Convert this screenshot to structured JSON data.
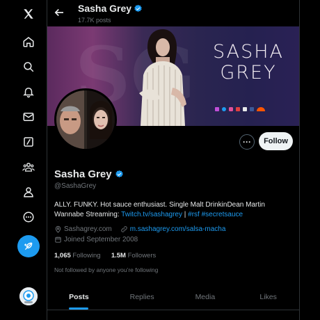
{
  "sidebar": {
    "items": [
      {
        "icon": "x-logo-icon"
      },
      {
        "icon": "home-icon"
      },
      {
        "icon": "search-icon"
      },
      {
        "icon": "notifications-bell-icon"
      },
      {
        "icon": "messages-envelope-icon"
      },
      {
        "icon": "grok-icon"
      },
      {
        "icon": "communities-icon"
      },
      {
        "icon": "profile-icon"
      },
      {
        "icon": "more-circle-icon"
      }
    ],
    "post_button_icon": "compose-feather-icon",
    "account_avatar_icon": "account-avatar-icon"
  },
  "header": {
    "title": "Sasha Grey",
    "post_count": "17.7K posts"
  },
  "banner": {
    "logo_line1": "SASHA",
    "logo_line2": "GREY"
  },
  "profile": {
    "display_name": "Sasha Grey",
    "handle": "@SashaGrey",
    "bio_text": "ALLY. FUNKY. Hot sauce enthusiast. Single Malt DrinkinDean Martin Wannabe Streaming: ",
    "bio_link": "Twitch.tv/sashagrey",
    "bio_sep": " | ",
    "bio_tags": "#rsf #secretsauce",
    "location": "Sashagrey.com",
    "website": "m.sashagrey.com/salsa-macha",
    "joined": "Joined September 2008",
    "following_count": "1,065",
    "following_label": "Following",
    "followers_count": "1.5M",
    "followers_label": "Followers",
    "not_followed": "Not followed by anyone you’re following",
    "follow_button": "Follow",
    "more_button": "···"
  },
  "tabs": [
    {
      "label": "Posts",
      "active": true
    },
    {
      "label": "Replies",
      "active": false
    },
    {
      "label": "Media",
      "active": false
    },
    {
      "label": "Likes",
      "active": false
    }
  ],
  "colors": {
    "accent": "#1d9bf0",
    "background": "#000000",
    "text_primary": "#e7e9ea",
    "text_secondary": "#71767b"
  }
}
